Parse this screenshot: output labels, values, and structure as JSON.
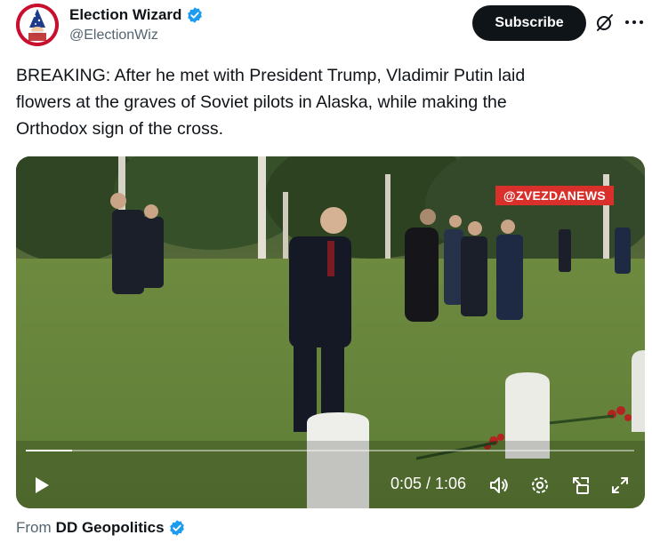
{
  "author": {
    "display_name": "Election Wizard",
    "handle": "@ElectionWiz",
    "verified": true
  },
  "actions": {
    "subscribe_label": "Subscribe",
    "grok_icon": "grok-icon",
    "more_icon": "more-icon"
  },
  "tweet": {
    "text": "BREAKING:  After he met with President Trump, Vladimir Putin laid\nflowers at the graves of Soviet pilots in Alaska, while making the\nOrthodox sign of the cross."
  },
  "video": {
    "watermark": "@ZVEZDANEWS",
    "current_time": "0:05",
    "duration": "1:06",
    "time_display": "0:05 / 1:06",
    "progress_fraction": 0.076,
    "icons": [
      "play-icon",
      "volume-icon",
      "settings-icon",
      "picture-in-picture-icon",
      "fullscreen-icon"
    ]
  },
  "source": {
    "from_label": "From",
    "name": "DD Geopolitics",
    "verified": true
  },
  "colors": {
    "verified_blue": "#1d9bf0",
    "text_primary": "#0f1419",
    "text_secondary": "#536471",
    "subscribe_bg": "#0f1419",
    "watermark_red": "#d9302c"
  }
}
